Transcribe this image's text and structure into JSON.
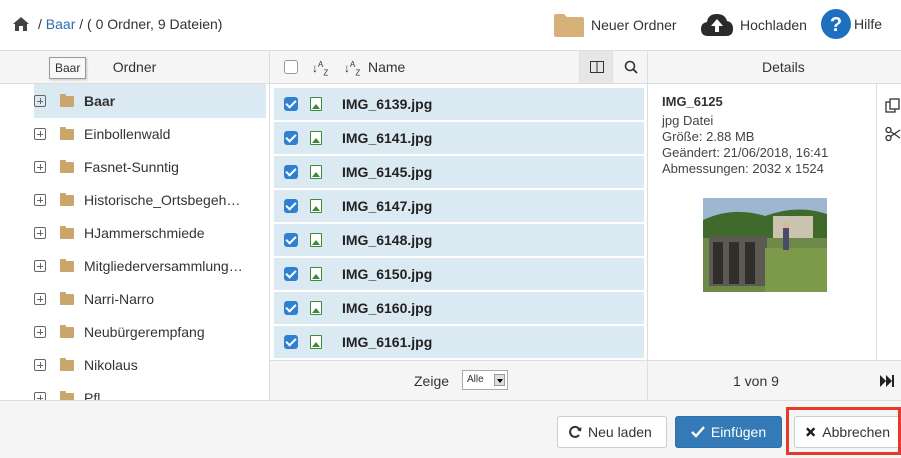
{
  "breadcrumb": {
    "separator": "/",
    "current": "Baar",
    "summary": "/ ( 0 Ordner, 9 Dateien)"
  },
  "toolbar": {
    "new_folder": "Neuer Ordner",
    "upload": "Hochladen",
    "help": "Hilfe"
  },
  "columns": {
    "folders": "Ordner",
    "name": "Name",
    "details": "Details"
  },
  "tooltip": "Baar",
  "folders": [
    {
      "label": "Baar",
      "selected": true
    },
    {
      "label": "Einbollenwald"
    },
    {
      "label": "Fasnet-Sunntig"
    },
    {
      "label": "Historische_Ortsbegeh…"
    },
    {
      "label": "HJammerschmiede"
    },
    {
      "label": "Mitgliederversammlung…"
    },
    {
      "label": "Narri-Narro"
    },
    {
      "label": "Neubürgerempfang"
    },
    {
      "label": "Nikolaus"
    },
    {
      "label": "Pfl…"
    }
  ],
  "files": [
    "IMG_6139.jpg",
    "IMG_6141.jpg",
    "IMG_6145.jpg",
    "IMG_6147.jpg",
    "IMG_6148.jpg",
    "IMG_6150.jpg",
    "IMG_6160.jpg",
    "IMG_6161.jpg"
  ],
  "files_footer": {
    "show_label": "Zeige",
    "show_value": "Alle"
  },
  "details": {
    "title": "IMG_6125",
    "type": "jpg Datei",
    "size": "Größe: 2.88 MB",
    "modified": "Geändert: 21/06/2018, 16:41",
    "dimensions": "Abmessungen: 2032 x 1524",
    "pager": "1 von 9"
  },
  "buttons": {
    "reload": "Neu laden",
    "insert": "Einfügen",
    "cancel": "Abbrechen"
  },
  "colors": {
    "accent": "#337ab7",
    "selection": "#dbe9f3",
    "highlight": "#e53a2b",
    "folder": "#c9a66b"
  }
}
